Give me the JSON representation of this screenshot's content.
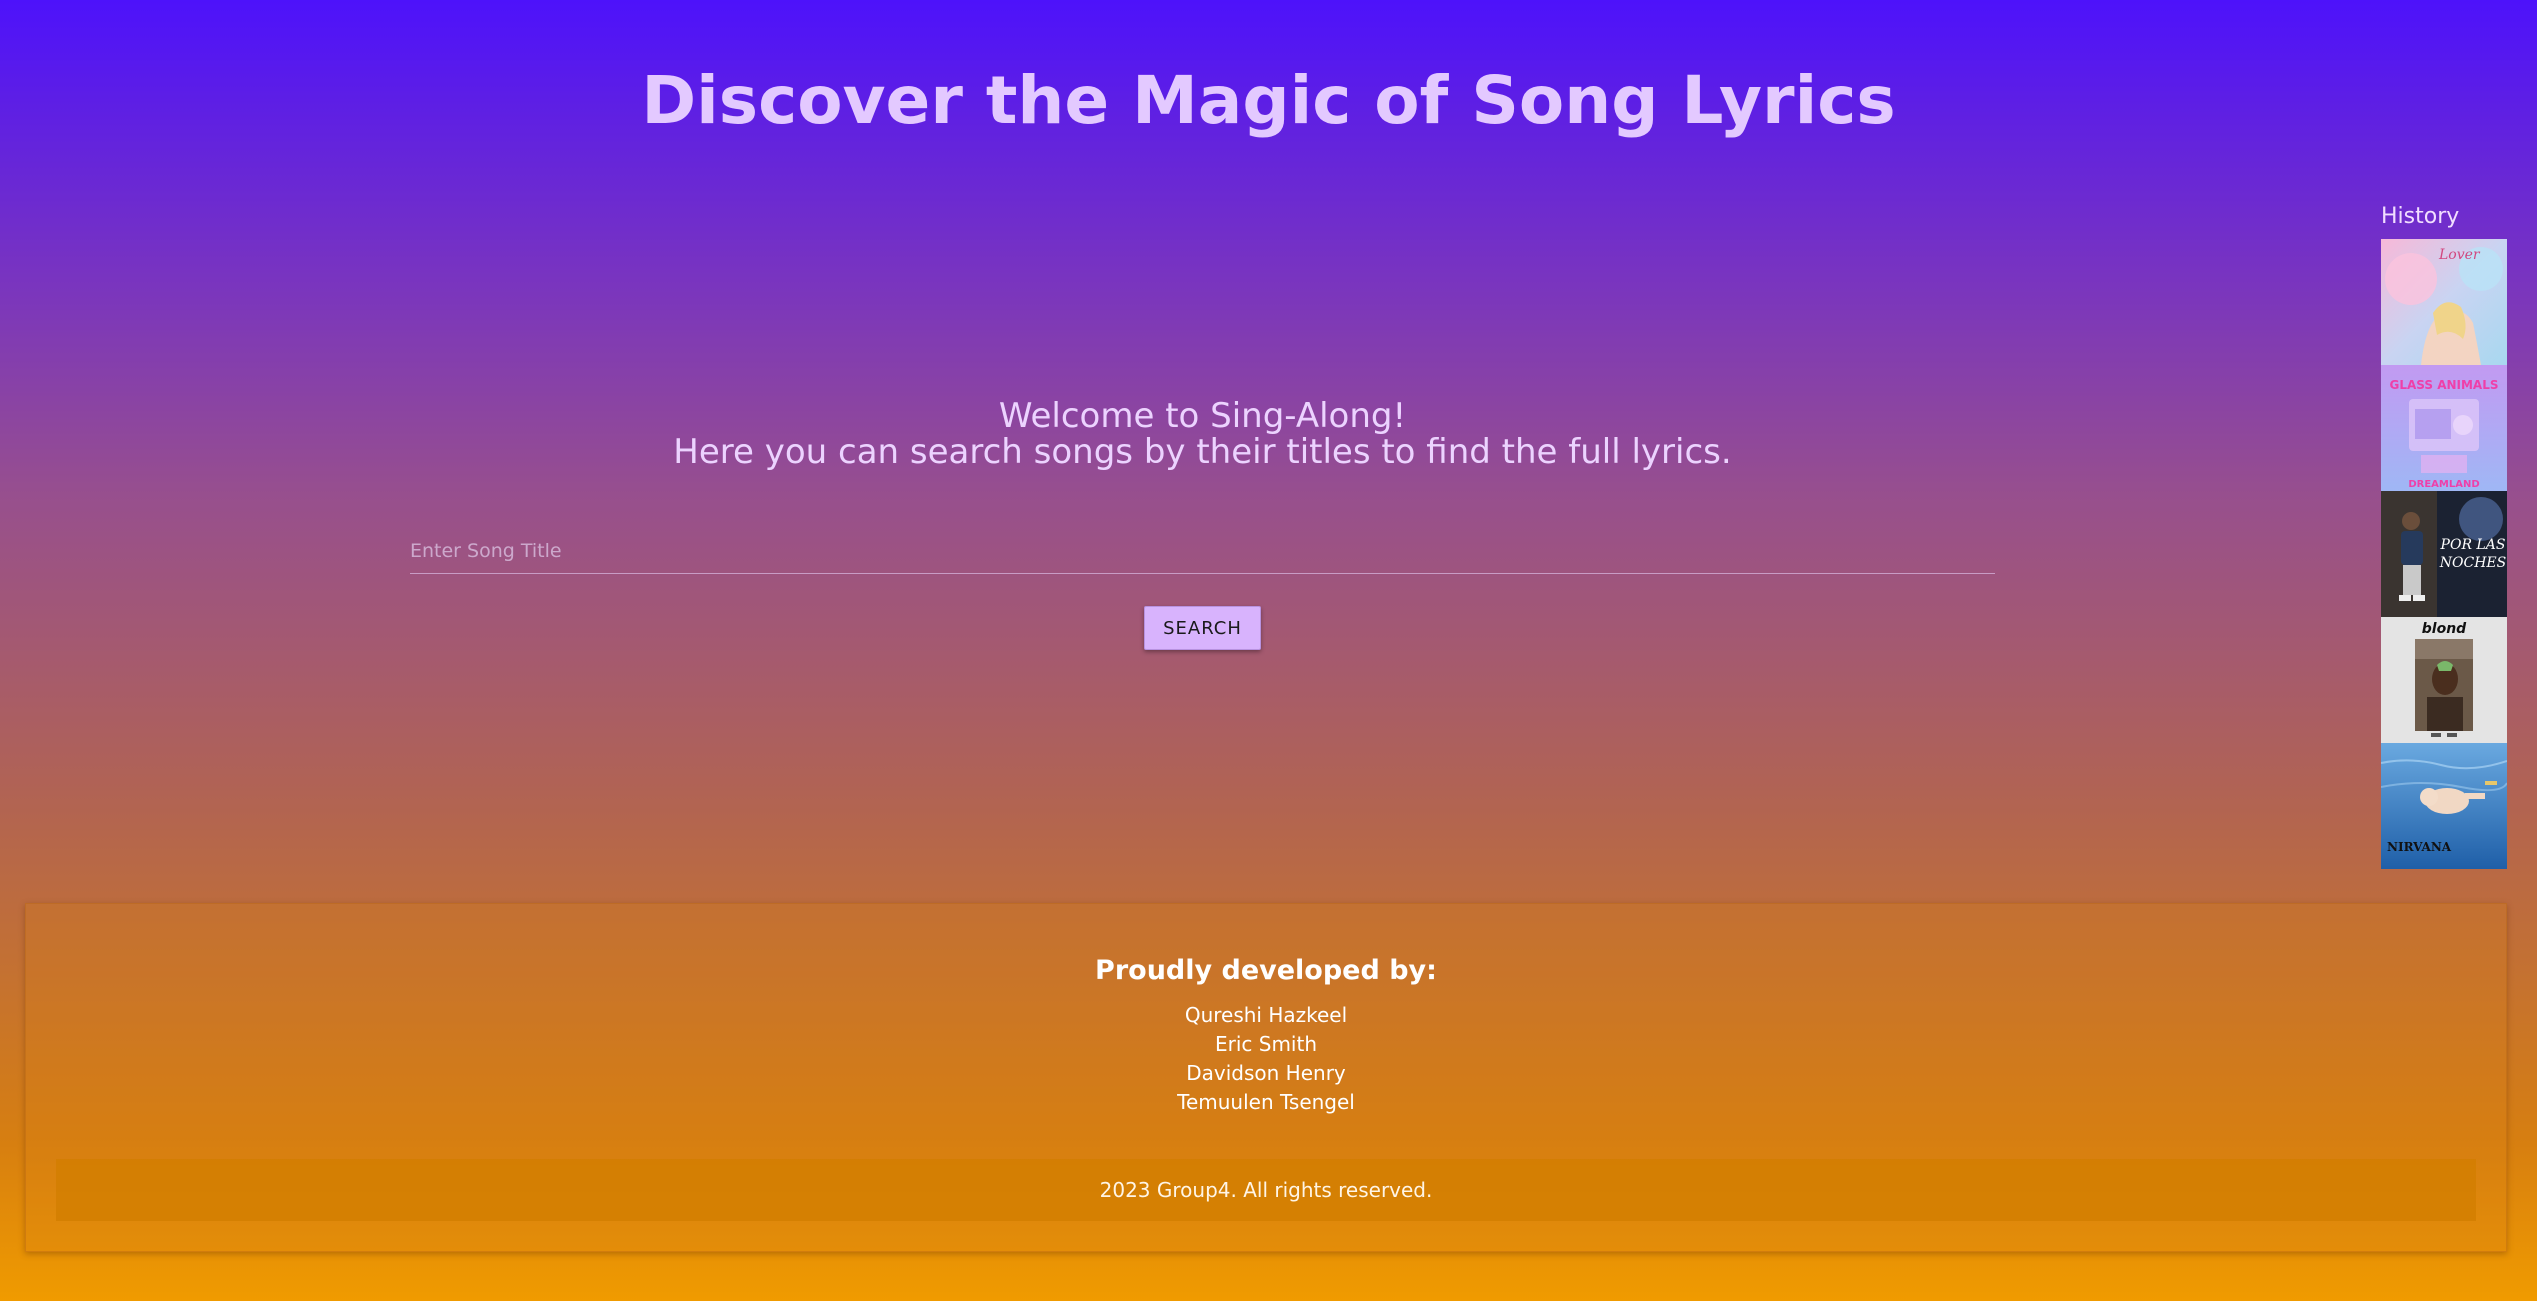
{
  "page": {
    "title": "Discover the Magic of Song Lyrics"
  },
  "welcome": {
    "line1": "Welcome to Sing-Along!",
    "line2": "Here you can search songs by their titles to find the full lyrics."
  },
  "search": {
    "placeholder": "Enter Song Title",
    "value": "",
    "button_label": "SEARCH"
  },
  "history": {
    "label": "History",
    "albums": [
      {
        "name": "lover-album-cover",
        "text": "Lover"
      },
      {
        "name": "glass-animals-dreamland-cover",
        "text": "GLASS ANIMALS",
        "subtext": "DREAMLAND"
      },
      {
        "name": "por-las-noches-cover",
        "text": "POR LAS",
        "subtext": "NOCHES"
      },
      {
        "name": "blond-album-cover",
        "text": "blond"
      },
      {
        "name": "nevermind-album-cover",
        "text": "NIRVANA"
      }
    ]
  },
  "footer": {
    "heading": "Proudly developed by:",
    "developers": [
      "Qureshi Hazkeel",
      "Eric Smith",
      "Davidson Henry",
      "Temuulen Tsengel"
    ],
    "copyright": "2023 Group4. All rights reserved."
  },
  "colors": {
    "gradient_top": "#4d12fb",
    "gradient_bottom": "#f09b00",
    "accent": "#d8b3fd",
    "title_text": "#e3c9ff"
  }
}
